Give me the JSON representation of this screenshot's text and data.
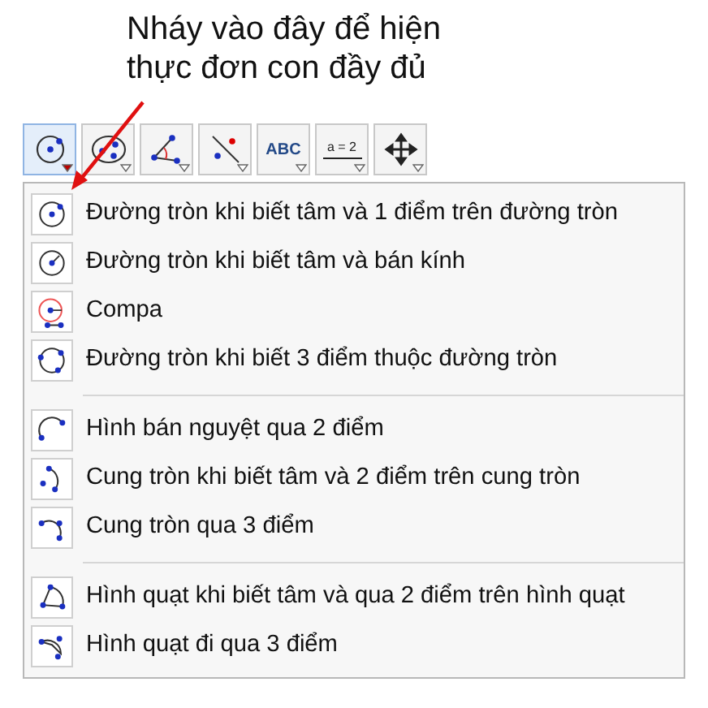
{
  "annotation": {
    "text": "Nháy vào đây để hiện thực đơn con đầy đủ"
  },
  "toolbar": [
    {
      "kind": "circle-center",
      "selected": true
    },
    {
      "kind": "ellipse",
      "selected": false
    },
    {
      "kind": "angle",
      "selected": false
    },
    {
      "kind": "line-point",
      "selected": false
    },
    {
      "kind": "text",
      "label": "ABC",
      "selected": false
    },
    {
      "kind": "slider",
      "label": "a = 2",
      "selected": false
    },
    {
      "kind": "move",
      "selected": false
    }
  ],
  "menu": {
    "groups": [
      {
        "items": [
          {
            "kind": "circle-center",
            "label": "Đường tròn khi biết tâm và 1 điểm trên đường tròn"
          },
          {
            "kind": "circle-radius",
            "label": "Đường tròn khi biết tâm và bán kính"
          },
          {
            "kind": "compass",
            "label": "Compa"
          },
          {
            "kind": "circle-3",
            "label": "Đường tròn khi biết 3 điểm thuộc đường tròn"
          }
        ]
      },
      {
        "items": [
          {
            "kind": "semicircle",
            "label": "Hình bán nguyệt qua 2 điểm"
          },
          {
            "kind": "arc-center",
            "label": "Cung tròn khi biết tâm và 2 điểm trên cung tròn"
          },
          {
            "kind": "arc-3",
            "label": "Cung tròn qua 3 điểm"
          }
        ]
      },
      {
        "items": [
          {
            "kind": "sector-center",
            "label": "Hình quạt khi biết tâm và qua 2 điểm trên hình quạt"
          },
          {
            "kind": "sector-3",
            "label": "Hình quạt đi qua 3 điểm"
          }
        ]
      }
    ]
  }
}
